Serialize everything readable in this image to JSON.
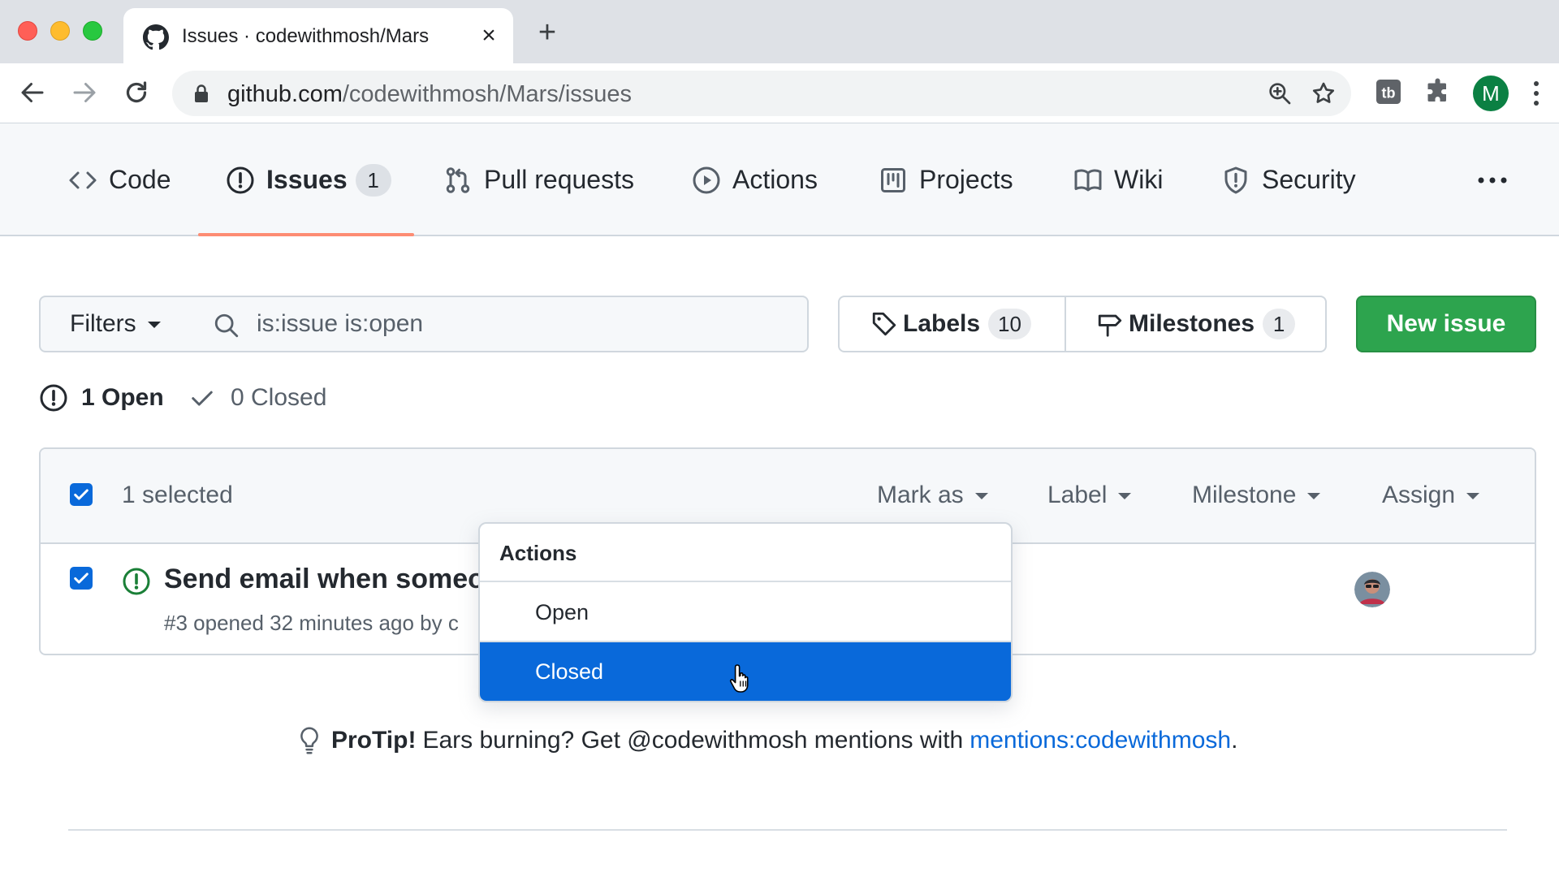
{
  "browser": {
    "tab_title": "Issues · codewithmosh/Mars",
    "tab_close": "×",
    "new_tab": "+",
    "url_host": "github.com",
    "url_path": "/codewithmosh/Mars/issues",
    "profile_initial": "M"
  },
  "repo_nav": {
    "items": [
      {
        "label": "Code",
        "icon": "code-icon"
      },
      {
        "label": "Issues",
        "icon": "issue-opened-icon",
        "counter": "1",
        "active": true
      },
      {
        "label": "Pull requests",
        "icon": "git-pull-request-icon"
      },
      {
        "label": "Actions",
        "icon": "play-icon"
      },
      {
        "label": "Projects",
        "icon": "project-icon"
      },
      {
        "label": "Wiki",
        "icon": "book-icon"
      },
      {
        "label": "Security",
        "icon": "shield-icon"
      }
    ]
  },
  "filters": {
    "button_label": "Filters",
    "search_value": "is:issue is:open"
  },
  "labels": {
    "label": "Labels",
    "count": "10"
  },
  "milestones": {
    "label": "Milestones",
    "count": "1"
  },
  "new_issue_label": "New issue",
  "states": {
    "open": "1 Open",
    "closed": "0 Closed"
  },
  "bulk": {
    "selected_text": "1 selected",
    "menus": [
      "Mark as",
      "Label",
      "Milestone",
      "Assign"
    ]
  },
  "issue": {
    "title": "Send email when someone",
    "meta": "#3 opened 32 minutes ago by c"
  },
  "dropdown": {
    "header": "Actions",
    "options": [
      "Open",
      "Closed"
    ],
    "highlighted": "Closed"
  },
  "protip": {
    "lead": "ProTip!",
    "text": "Ears burning? Get @codewithmosh mentions with",
    "link": "mentions:codewithmosh",
    "end": "."
  },
  "colors": {
    "primary_green": "#2da44e",
    "accent_blue": "#0969da",
    "active_tab_underline": "#fd8c73"
  }
}
